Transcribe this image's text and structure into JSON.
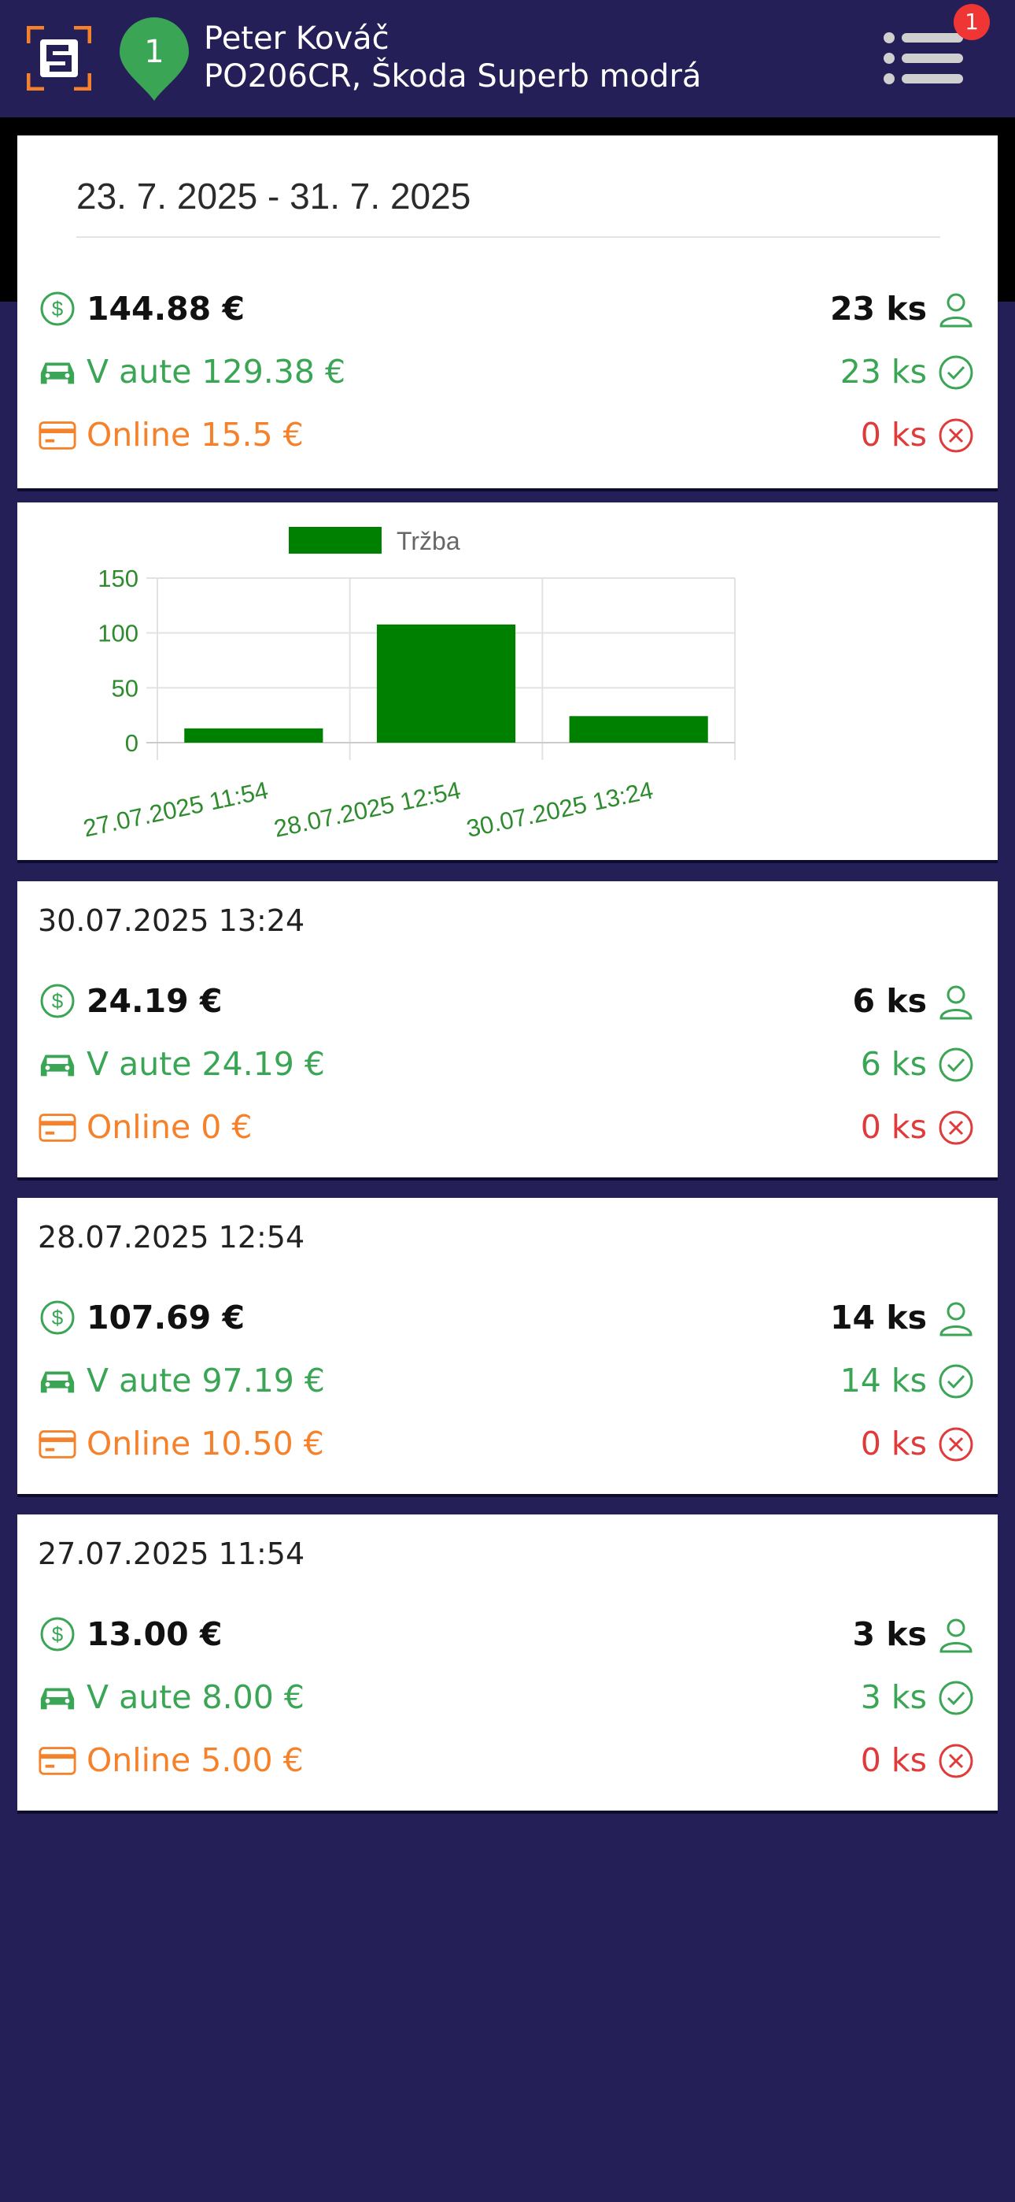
{
  "header": {
    "pin_number": "1",
    "driver_name": "Peter Kováč",
    "vehicle": "PO206CR, Škoda Superb modrá",
    "menu_badge": "1",
    "colors": {
      "background": "#251f57",
      "logo": "#f5822a",
      "pin": "#3aa655",
      "badge": "#f03535"
    }
  },
  "summary": {
    "date_range": "23. 7. 2025 - 31. 7. 2025",
    "total_amount": "144.88 €",
    "total_count": "23 ks",
    "in_car_label": "V aute 129.38 €",
    "in_car_count": "23 ks",
    "online_label": "Online 15.5 €",
    "online_count": "0 ks"
  },
  "chart_data": {
    "type": "bar",
    "legend": "Tržba",
    "categories": [
      "27.07.2025 11:54",
      "28.07.2025 12:54",
      "30.07.2025 13:24"
    ],
    "series": [
      {
        "name": "Tržba",
        "values": [
          13.0,
          107.69,
          24.19
        ],
        "color": "#008000"
      }
    ],
    "yticks": [
      0,
      50,
      100,
      150
    ],
    "ylim": [
      0,
      150
    ],
    "grid": true,
    "legend_position": "top"
  },
  "entries": [
    {
      "date": "30.07.2025 13:24",
      "total_amount": "24.19 €",
      "total_count": "6 ks",
      "in_car_label": "V aute 24.19 €",
      "in_car_count": "6 ks",
      "online_label": "Online 0 €",
      "online_count": "0 ks"
    },
    {
      "date": "28.07.2025 12:54",
      "total_amount": "107.69 €",
      "total_count": "14 ks",
      "in_car_label": "V aute 97.19 €",
      "in_car_count": "14 ks",
      "online_label": "Online 10.50 €",
      "online_count": "0 ks"
    },
    {
      "date": "27.07.2025 11:54",
      "total_amount": "13.00 €",
      "total_count": "3 ks",
      "in_car_label": "V aute 8.00 €",
      "in_car_count": "3 ks",
      "online_label": "Online 5.00 €",
      "online_count": "0 ks"
    }
  ]
}
